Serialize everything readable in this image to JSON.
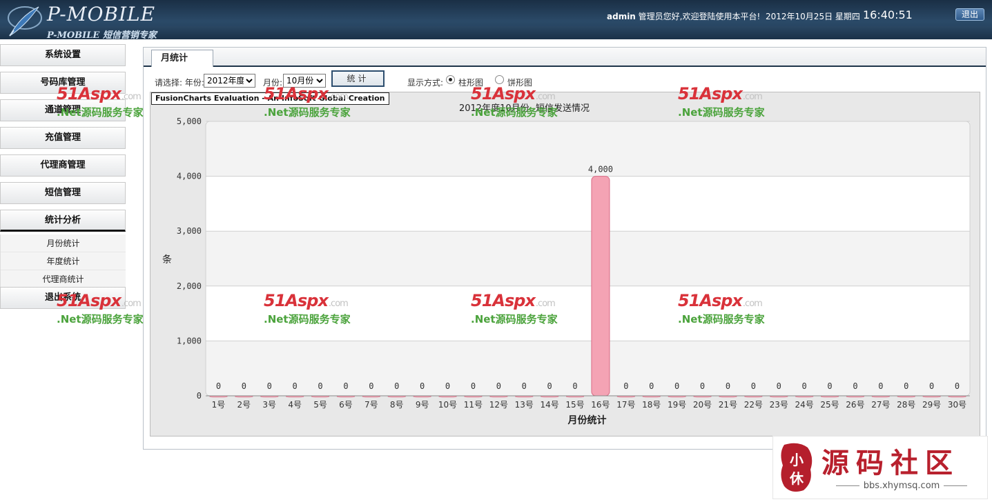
{
  "header": {
    "logo_text": "P-MOBILE",
    "logo_subtitle": "P-MOBILE 短信营销专家",
    "user": "admin",
    "welcome_text": " 管理员您好,欢迎登陆使用本平台!",
    "date": "2012年10月25日  星期四",
    "time": "16:40:51",
    "logout_label": "退出"
  },
  "sidebar": {
    "items": [
      {
        "label": "系统设置"
      },
      {
        "label": "号码库管理"
      },
      {
        "label": "通道管理"
      },
      {
        "label": "充值管理"
      },
      {
        "label": "代理商管理"
      },
      {
        "label": "短信管理"
      },
      {
        "label": "统计分析"
      }
    ],
    "submenu": [
      {
        "label": "月份统计"
      },
      {
        "label": "年度统计"
      },
      {
        "label": "代理商统计"
      }
    ],
    "exit_label": "退出系统"
  },
  "tab": {
    "label": "月统计"
  },
  "filter": {
    "prompt": "请选择: 年份:",
    "year_value": "2012年度",
    "month_label": "月份:",
    "month_value": "10月份",
    "stat_button": "统计",
    "display_label": "显示方式:",
    "option_bar": "柱形图",
    "option_pie": "饼形图",
    "selected": "bar"
  },
  "chart_banner": "FusionCharts Evaluation - An InfoSoft Global Creation",
  "chart_data": {
    "type": "bar",
    "title": "2012年度10月份--短信发送情况",
    "xlabel": "月份统计",
    "ylabel": "条",
    "ylim": [
      0,
      5000
    ],
    "yticks": [
      "0",
      "1,000",
      "2,000",
      "3,000",
      "4,000",
      "5,000"
    ],
    "categories": [
      "1号",
      "2号",
      "3号",
      "4号",
      "5号",
      "6号",
      "7号",
      "8号",
      "9号",
      "10号",
      "11号",
      "12号",
      "13号",
      "14号",
      "15号",
      "16号",
      "17号",
      "18号",
      "19号",
      "20号",
      "21号",
      "22号",
      "23号",
      "24号",
      "25号",
      "26号",
      "27号",
      "28号",
      "29号",
      "30号"
    ],
    "values": [
      0,
      0,
      0,
      0,
      0,
      0,
      0,
      0,
      0,
      0,
      0,
      0,
      0,
      0,
      0,
      4000,
      0,
      0,
      0,
      0,
      0,
      0,
      0,
      0,
      0,
      0,
      0,
      0,
      0,
      0
    ],
    "value_labels": [
      "0",
      "0",
      "0",
      "0",
      "0",
      "0",
      "0",
      "0",
      "0",
      "0",
      "0",
      "0",
      "0",
      "0",
      "0",
      "4,000",
      "0",
      "0",
      "0",
      "0",
      "0",
      "0",
      "0",
      "0",
      "0",
      "0",
      "0",
      "0",
      "0",
      "0"
    ],
    "bar_color": "#f4a3b4",
    "grid": true
  },
  "watermark": {
    "brand": "51Aspx",
    "domain": ".com",
    "tagline": ".Net源码服务专家"
  },
  "badge": {
    "seal_text": "小 休",
    "title": "源码社区",
    "url": "bbs.xhymsq.com"
  }
}
